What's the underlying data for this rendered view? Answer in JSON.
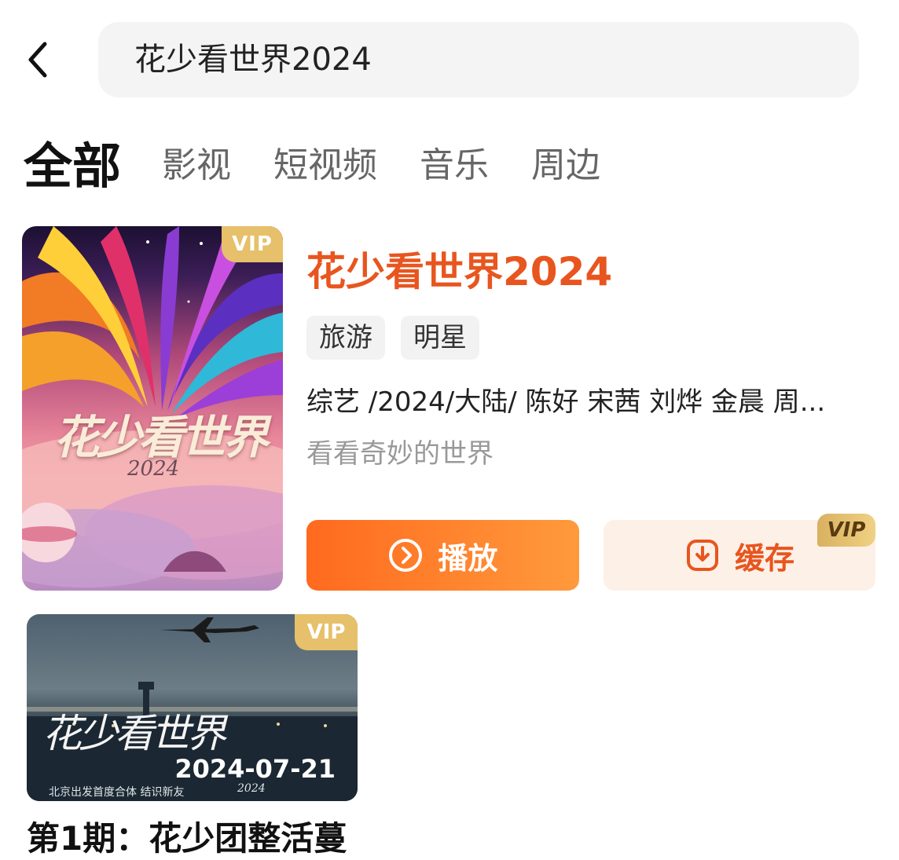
{
  "search": {
    "query": "花少看世界2024"
  },
  "tabs": [
    {
      "label": "全部",
      "active": true
    },
    {
      "label": "影视",
      "active": false
    },
    {
      "label": "短视频",
      "active": false
    },
    {
      "label": "音乐",
      "active": false
    },
    {
      "label": "周边",
      "active": false
    }
  ],
  "show": {
    "vip": "VIP",
    "poster_art_text": "花少看世界",
    "poster_art_year": "2024",
    "title": "花少看世界2024",
    "tags": [
      "旅游",
      "明星"
    ],
    "meta": "综艺 /2024/大陆/ 陈好 宋茜 刘烨 金晨 周...",
    "description": "看看奇妙的世界",
    "play_label": "播放",
    "cache_label": "缓存",
    "cache_badge": "VIP"
  },
  "episode": {
    "vip": "VIP",
    "art_text": "花少看世界",
    "art_year": "2024",
    "date": "2024-07-21",
    "subtitle": "北京出发首度合体  结识新友",
    "title": "第1期：花少团整活蔓"
  },
  "colors": {
    "accent": "#e8551f",
    "vip_gold": "#e6c06a"
  }
}
